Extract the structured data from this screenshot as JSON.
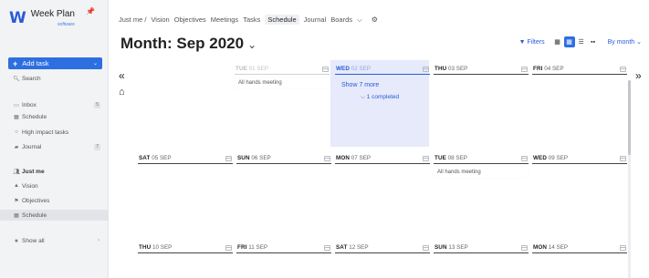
{
  "sidebar": {
    "logo_name": "Week Plan",
    "logo_sub": "software",
    "add_task": "Add task",
    "search": "Search",
    "items": [
      {
        "label": "Inbox",
        "count": "5",
        "icon": "inbox-icon"
      },
      {
        "label": "Schedule",
        "icon": "calendar-icon"
      },
      {
        "label": "High impact tasks",
        "icon": "circle-icon"
      },
      {
        "label": "Journal",
        "count": "7",
        "icon": "book-icon"
      }
    ],
    "section": {
      "title": "Just me",
      "items": [
        {
          "label": "Vision",
          "icon": "mountain-icon"
        },
        {
          "label": "Objectives",
          "icon": "flag-icon"
        },
        {
          "label": "Schedule",
          "icon": "calendar-icon"
        }
      ]
    },
    "show_all": "Show all"
  },
  "topnav": {
    "context": "Just me /",
    "tabs": [
      "Vision",
      "Objectives",
      "Meetings",
      "Tasks",
      "Schedule",
      "Journal",
      "Boards"
    ],
    "boards_caret": "⌵"
  },
  "header": {
    "title": "Month: Sep 2020",
    "filters": "Filters",
    "by_month": "By month"
  },
  "days": [
    {
      "name": "TUE",
      "date": "01 SEP",
      "style": "dim",
      "tasks": [
        "All hands meeting"
      ]
    },
    {
      "name": "WED",
      "date": "02 SEP",
      "style": "blue",
      "tasks": []
    },
    {
      "name": "THU",
      "date": "03 SEP",
      "style": "normal",
      "tasks": []
    },
    {
      "name": "FRI",
      "date": "04 SEP",
      "style": "normal",
      "tasks": []
    },
    {
      "name": "SAT",
      "date": "05 SEP",
      "style": "normal",
      "tasks": []
    },
    {
      "name": "SUN",
      "date": "06 SEP",
      "style": "normal",
      "tasks": []
    },
    {
      "name": "MON",
      "date": "07 SEP",
      "style": "normal",
      "tasks": []
    },
    {
      "name": "TUE",
      "date": "08 SEP",
      "style": "normal",
      "tasks": [
        "All hands meeting"
      ]
    },
    {
      "name": "WED",
      "date": "09 SEP",
      "style": "normal",
      "tasks": []
    },
    {
      "name": "THU",
      "date": "10 SEP",
      "style": "normal",
      "tasks": []
    },
    {
      "name": "FRI",
      "date": "11 SEP",
      "style": "normal",
      "tasks": []
    },
    {
      "name": "SAT",
      "date": "12 SEP",
      "style": "normal",
      "tasks": []
    },
    {
      "name": "SUN",
      "date": "13 SEP",
      "style": "normal",
      "tasks": []
    },
    {
      "name": "MON",
      "date": "14 SEP",
      "style": "normal",
      "tasks": []
    }
  ],
  "today": {
    "show_more": "Show 7 more",
    "completed": "⌵ 1 completed"
  },
  "colors": {
    "accent": "#2d6fe0",
    "today_bg": "#e6eafa",
    "sidebar_bg": "#f2f3f5"
  }
}
